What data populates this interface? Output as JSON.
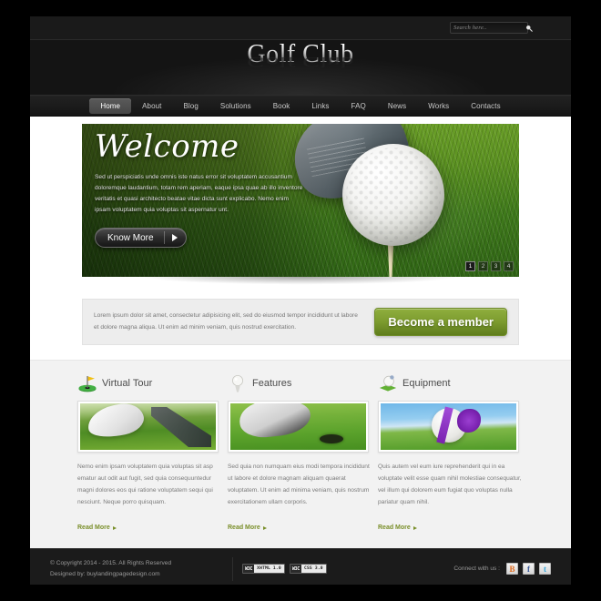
{
  "colors": {
    "accent_green": "#7d9c2f",
    "link_green": "#7a8f2a",
    "header_dark": "#141414",
    "footer_dark": "#1b1b1b",
    "features_bg": "#f2f2f2"
  },
  "search": {
    "placeholder": "Search here..",
    "value": "",
    "icon": "search-icon"
  },
  "header": {
    "logo": "Golf Club"
  },
  "nav": {
    "items": [
      {
        "label": "Home",
        "active": true
      },
      {
        "label": "About",
        "active": false
      },
      {
        "label": "Blog",
        "active": false
      },
      {
        "label": "Solutions",
        "active": false
      },
      {
        "label": "Book",
        "active": false
      },
      {
        "label": "Links",
        "active": false
      },
      {
        "label": "FAQ",
        "active": false
      },
      {
        "label": "News",
        "active": false
      },
      {
        "label": "Works",
        "active": false
      },
      {
        "label": "Contacts",
        "active": false
      }
    ]
  },
  "hero": {
    "title": "Welcome",
    "text": "Sed ut perspiciatis unde omnis iste natus error sit voluptatem accusantium doloremque laudantium, totam rem aperiam, eaque ipsa quae ab illo inventore veritatis et quasi architecto beatae vitae dicta sunt explicabo. Nemo enim ipsam voluptatem quia voluptas sit aspernatur unt.",
    "button_label": "Know More",
    "slides": [
      {
        "label": "1",
        "active": true
      },
      {
        "label": "2",
        "active": false
      },
      {
        "label": "3",
        "active": false
      },
      {
        "label": "4",
        "active": false
      }
    ]
  },
  "callout": {
    "text": "Lorem ipsum dolor sit amet, consectetur adipisicing elit, sed do eiusmod tempor incididunt ut labore et dolore magna aliqua. Ut enim ad minim veniam, quis nostrud exercitation.",
    "button_label": "Become a member"
  },
  "features": {
    "read_more_label": "Read More",
    "columns": [
      {
        "title": "Virtual Tour",
        "icon": "golf-flag-hole-icon",
        "image": "gloved-hand-placing-ball-on-tee-photo",
        "text": "Nemo enim ipsam voluptatem quia voluptas sit asp ematur aut odit aut fugit, sed quia consequuntedur magni dolores eos qui ratione voluptatem sequi qui nesciunt. Neque porro quisquam."
      },
      {
        "title": "Features",
        "icon": "golf-ball-on-tee-icon",
        "image": "golfer-putting-near-hole-photo",
        "text": "Sed quia non numquam eius modi tempora incididunt ut labore et dolore magnam aliquam quaerat voluptatem. Ut enim ad minima veniam, quis nostrum exercitationem ullam corporis."
      },
      {
        "title": "Equipment",
        "icon": "golf-ball-on-grass-icon",
        "image": "golf-ball-with-purple-ribbon-on-tee-photo",
        "text": "Quis autem vel eum iure reprehenderit qui in ea voluptate velit esse quam nihil molestiae consequatur, vel illum qui dolorem eum fugiat quo voluptas nulla pariatur quam nihil."
      }
    ]
  },
  "footer": {
    "copyright": "© Copyright 2014 - 2015. All Rights Reserved",
    "designed_by": "Designed by: buylandingpagedesign.com",
    "badges": [
      {
        "mark": "W3C",
        "label": "XHTML 1.0"
      },
      {
        "mark": "W3C",
        "label": "CSS 3.0"
      }
    ],
    "social_label": "Connect with us :",
    "social": [
      {
        "name": "blogger",
        "glyph": "B"
      },
      {
        "name": "facebook",
        "glyph": "f"
      },
      {
        "name": "twitter",
        "glyph": "t"
      }
    ]
  }
}
